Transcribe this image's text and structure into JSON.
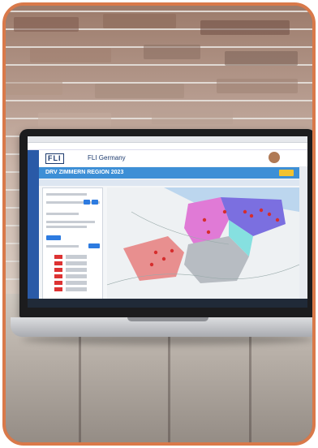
{
  "app": {
    "logo": "FLI",
    "name": "FLI Germany",
    "banner_title": "DRV ZIMMERN REGION 2023"
  },
  "colors": {
    "frame": "#d9794a",
    "app_header_blue": "#3d8fd6",
    "map_red": "#e24d4d",
    "map_pink": "#e07ad6",
    "map_purple": "#7b6fe0",
    "map_gray": "#b7bcc2"
  },
  "icons": [
    "person-avatar-icon",
    "map-pin-icon"
  ]
}
